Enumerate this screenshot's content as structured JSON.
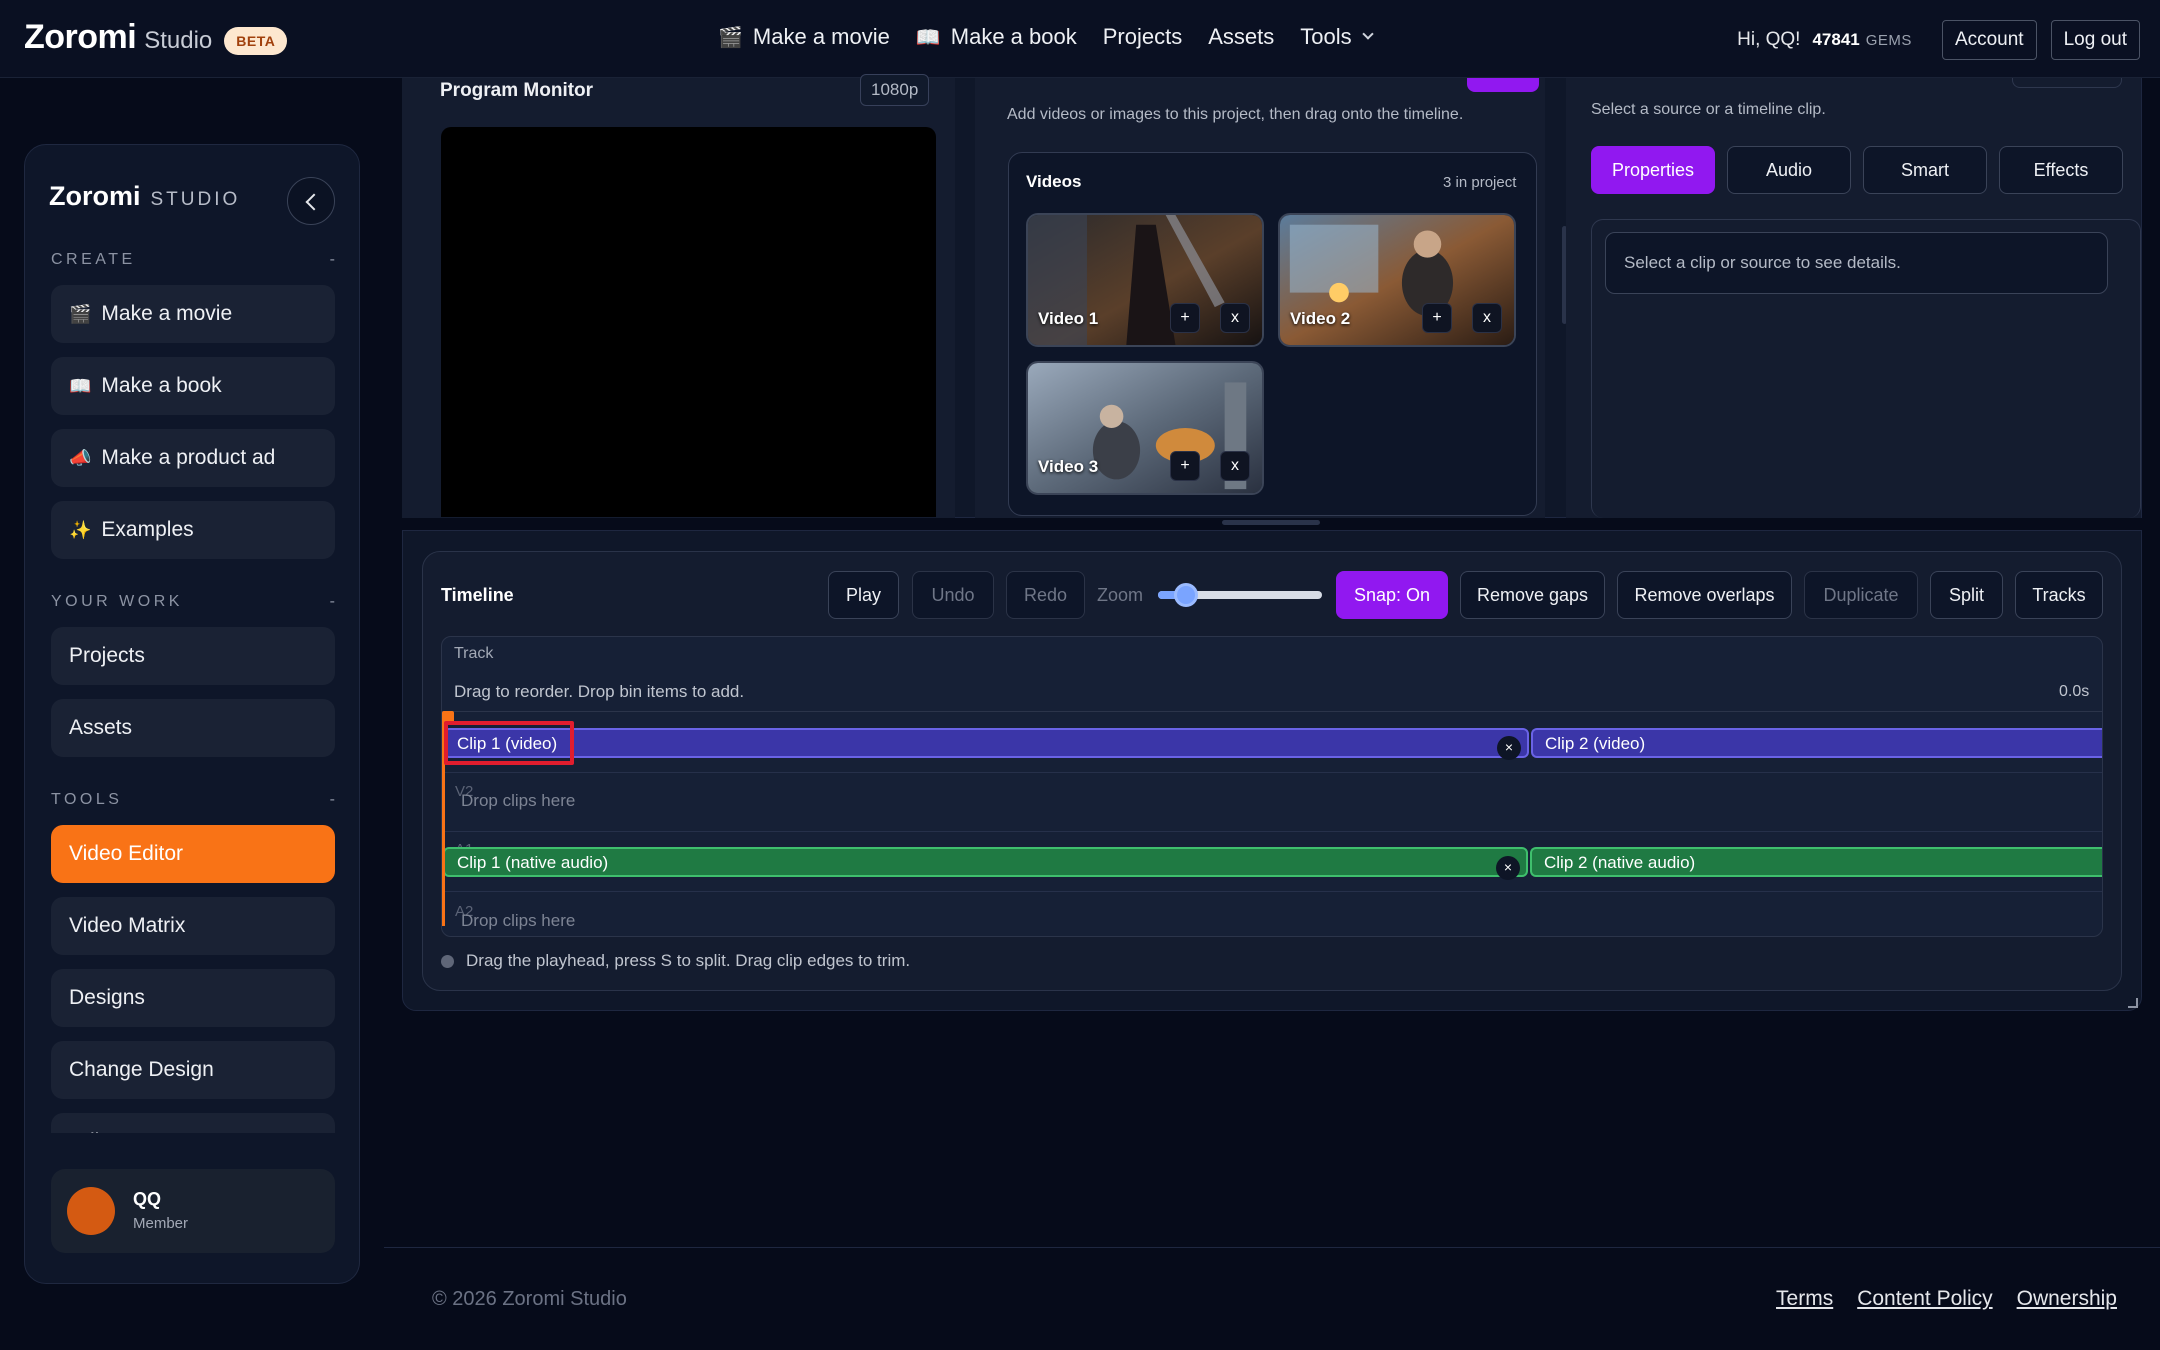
{
  "header": {
    "brand": "Zoromi",
    "brand_sub": "Studio",
    "beta": "BETA",
    "nav": [
      {
        "icon": "clapperboard-icon",
        "glyph": "🎬",
        "label": "Make a movie"
      },
      {
        "icon": "book-icon",
        "glyph": "📖",
        "label": "Make a book"
      },
      {
        "label": "Projects"
      },
      {
        "label": "Assets"
      },
      {
        "label": "Tools"
      }
    ],
    "greeting": "Hi, QQ!",
    "gems_count": "47841",
    "gems_label": "GEMS",
    "account": "Account",
    "logout": "Log out"
  },
  "sidebar": {
    "logo": "Zoromi",
    "logo_sub": "STUDIO",
    "sections": {
      "create": "CREATE",
      "your_work": "YOUR WORK",
      "tools": "TOOLS",
      "collapse_mark": "-"
    },
    "create_items": [
      {
        "glyph": "🎬",
        "label": "Make a movie"
      },
      {
        "glyph": "📖",
        "label": "Make a book"
      },
      {
        "glyph": "📣",
        "label": "Make a product ad"
      },
      {
        "glyph": "✨",
        "label": "Examples"
      }
    ],
    "work_items": [
      {
        "label": "Projects"
      },
      {
        "label": "Assets"
      }
    ],
    "tool_items": [
      {
        "label": "Video Editor",
        "active": true
      },
      {
        "label": "Video Matrix"
      },
      {
        "label": "Designs"
      },
      {
        "label": "Change Design"
      },
      {
        "label": "Edit Image"
      }
    ],
    "user": {
      "name": "QQ",
      "role": "Member"
    }
  },
  "program_monitor": {
    "title": "Program Monitor",
    "resolution": "1080p"
  },
  "bin": {
    "hint": "Add videos or images to this project, then drag onto the timeline.",
    "videos_title": "Videos",
    "videos_count": "3 in project",
    "videos": [
      {
        "name": "Video 1",
        "add": "+",
        "remove": "x"
      },
      {
        "name": "Video 2",
        "add": "+",
        "remove": "x"
      },
      {
        "name": "Video 3",
        "add": "+",
        "remove": "x"
      }
    ]
  },
  "properties": {
    "hint": "Select a source or a timeline clip.",
    "tabs": [
      "Properties",
      "Audio",
      "Smart",
      "Effects"
    ],
    "active_tab": "Properties",
    "details": "Select a clip or source to see details."
  },
  "timeline": {
    "title": "Timeline",
    "buttons": {
      "play": "Play",
      "undo": "Undo",
      "redo": "Redo",
      "zoom": "Zoom",
      "snap": "Snap: On",
      "remove_gaps": "Remove gaps",
      "remove_overlaps": "Remove overlaps",
      "duplicate": "Duplicate",
      "split": "Split",
      "tracks": "Tracks"
    },
    "zoom_level": 0.17,
    "track_label": "Track",
    "track_hint": "Drag to reorder. Drop bin items to add.",
    "time": "0.0s",
    "lanes": {
      "v2": "V2",
      "a1": "A1",
      "a2": "A2"
    },
    "drop_hint": "Drop clips here",
    "clips": {
      "v1_a": "Clip 1 (video)",
      "v1_b": "Clip 2 (video)",
      "a1_a": "Clip 1 (native audio)",
      "a1_b": "Clip 2 (native audio)",
      "close": "×"
    },
    "status": "Drag the playhead, press S to split. Drag clip edges to trim."
  },
  "footer": {
    "copyright": "© 2026 Zoromi Studio",
    "links": [
      "Terms",
      "Content Policy",
      "Ownership"
    ]
  },
  "colors": {
    "accent_orange": "#f97316",
    "accent_purple": "#9118f0",
    "video_clip": "#3b36a8",
    "audio_clip": "#1f7a43",
    "selection": "#e11d2e"
  }
}
